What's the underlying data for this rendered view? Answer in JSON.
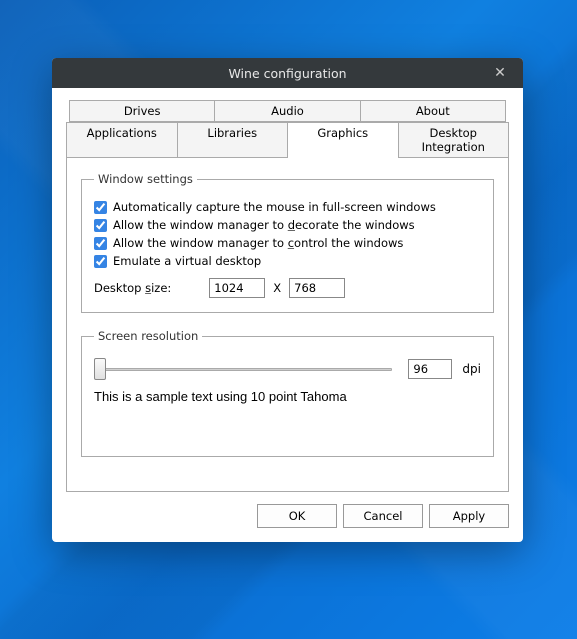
{
  "window": {
    "title": "Wine configuration"
  },
  "tabs": {
    "row1": {
      "drives": "Drives",
      "audio": "Audio",
      "about": "About"
    },
    "row2": {
      "applications": "Applications",
      "libraries": "Libraries",
      "graphics": "Graphics",
      "desktop": "Desktop Integration"
    }
  },
  "window_settings": {
    "legend": "Window settings",
    "capture": "Automatically capture the mouse in full-screen windows",
    "decorate_pre": "Allow the window manager to ",
    "decorate_u": "d",
    "decorate_post": "ecorate the windows",
    "control_pre": "Allow the window manager to ",
    "control_u": "c",
    "control_post": "ontrol the windows",
    "emulate": "Emulate a virtual desktop",
    "size_label_pre": "Desktop ",
    "size_label_u": "s",
    "size_label_post": "ize:",
    "width": "1024",
    "x": "X",
    "height": "768"
  },
  "screen_res": {
    "legend": "Screen resolution",
    "dpi_value": "96",
    "dpi_unit": "dpi",
    "sample": "This is a sample text using 10 point Tahoma"
  },
  "buttons": {
    "ok": "OK",
    "cancel": "Cancel",
    "apply": "Apply"
  }
}
